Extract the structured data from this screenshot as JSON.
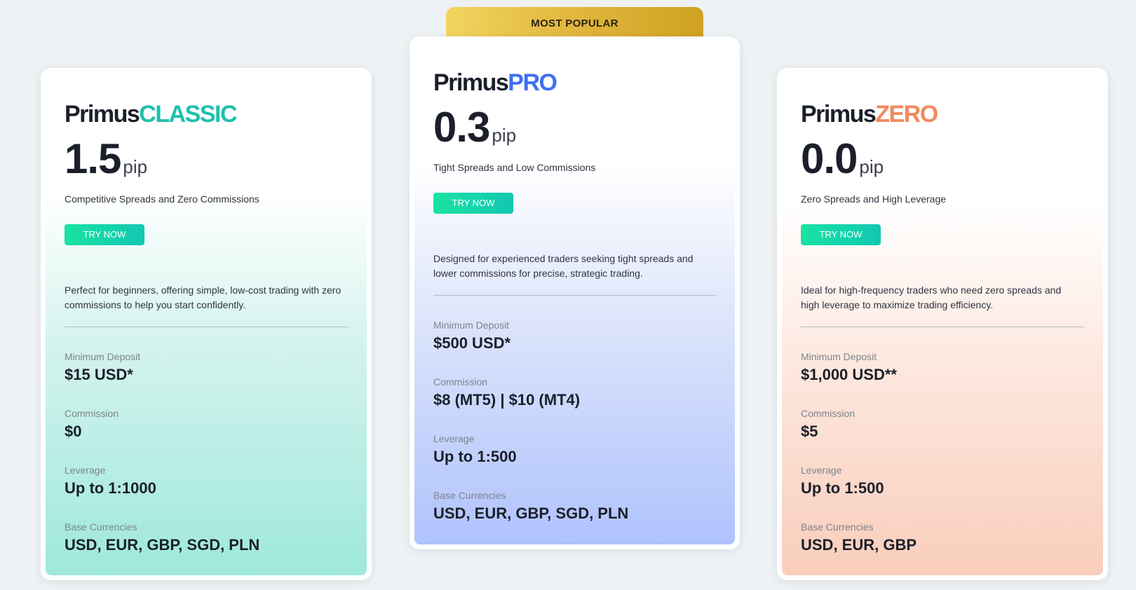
{
  "ribbon": {
    "label": "MOST POPULAR"
  },
  "plans": {
    "classic": {
      "brand_base": "Primus",
      "brand_accent": "CLASSIC",
      "spread_value": "1.5",
      "spread_unit": "pip",
      "tagline": "Competitive Spreads and Zero Commissions",
      "button_label": "TRY NOW",
      "description": "Perfect for beginners, offering simple, low-cost trading with zero commissions to help you start confidently.",
      "features": [
        {
          "label": "Minimum Deposit",
          "value": "$15 USD*"
        },
        {
          "label": "Commission",
          "value": "$0"
        },
        {
          "label": "Leverage",
          "value": "Up to 1:1000"
        },
        {
          "label": "Base Currencies",
          "value": "USD, EUR, GBP, SGD, PLN"
        }
      ]
    },
    "pro": {
      "brand_base": "Primus",
      "brand_accent": "PRO",
      "spread_value": "0.3",
      "spread_unit": "pip",
      "tagline": "Tight Spreads and Low Commissions",
      "button_label": "TRY NOW",
      "description": "Designed for experienced traders seeking tight spreads and lower commissions for precise, strategic trading.",
      "features": [
        {
          "label": "Minimum Deposit",
          "value": "$500 USD*"
        },
        {
          "label": "Commission",
          "value": "$8 (MT5) | $10 (MT4)"
        },
        {
          "label": "Leverage",
          "value": "Up to 1:500"
        },
        {
          "label": "Base Currencies",
          "value": "USD, EUR, GBP, SGD, PLN"
        }
      ]
    },
    "zero": {
      "brand_base": "Primus",
      "brand_accent": "ZERO",
      "spread_value": "0.0",
      "spread_unit": "pip",
      "tagline": "Zero Spreads and High Leverage",
      "button_label": "TRY NOW",
      "description": "Ideal for high-frequency traders who need zero spreads and high leverage to maximize trading efficiency.",
      "features": [
        {
          "label": "Minimum Deposit",
          "value": "$1,000 USD**"
        },
        {
          "label": "Commission",
          "value": "$5"
        },
        {
          "label": "Leverage",
          "value": "Up to 1:500"
        },
        {
          "label": "Base Currencies",
          "value": "USD, EUR, GBP"
        }
      ]
    }
  },
  "colors": {
    "classic_accent": "#1ebfae",
    "pro_accent": "#3f6ff4",
    "zero_accent": "#f08a5d",
    "button": "#12c7b3",
    "ribbon": "#dfb43a"
  }
}
